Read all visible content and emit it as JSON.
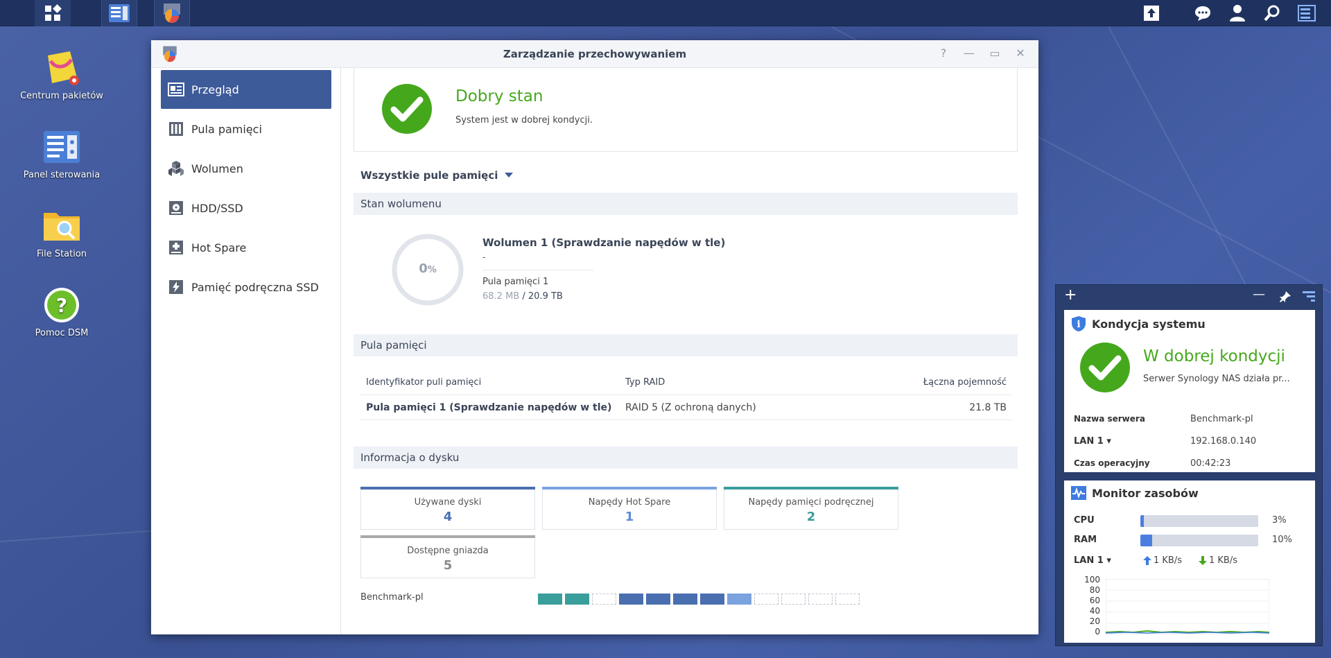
{
  "desktop": {
    "icons": [
      {
        "label": "Centrum pakietów"
      },
      {
        "label": "Panel sterowania"
      },
      {
        "label": "File Station"
      },
      {
        "label": "Pomoc DSM"
      }
    ]
  },
  "window": {
    "title": "Zarządzanie przechowywaniem",
    "controls": {
      "help": "?",
      "minimize": "—",
      "maximize": "▭",
      "close": "✕"
    },
    "sidebar": {
      "items": [
        {
          "label": "Przegląd",
          "icon": "overview-icon",
          "active": true
        },
        {
          "label": "Pula pamięci",
          "icon": "storage-pool-icon"
        },
        {
          "label": "Wolumen",
          "icon": "volume-icon"
        },
        {
          "label": "HDD/SSD",
          "icon": "hdd-icon"
        },
        {
          "label": "Hot Spare",
          "icon": "hot-spare-icon"
        },
        {
          "label": "Pamięć podręczna SSD",
          "icon": "ssd-cache-icon"
        }
      ]
    },
    "status": {
      "title": "Dobry stan",
      "description": "System jest w dobrej kondycji."
    },
    "pool_filter": "Wszystkie pule pamięci",
    "volume_section": {
      "header": "Stan wolumenu",
      "percent": "0",
      "percent_unit": "%",
      "progress": 0,
      "volume_name": "Wolumen 1 (Sprawdzanie napędów w tle)",
      "volume_sub": "-",
      "pool_name": "Pula pamięci 1",
      "used": "68.2 MB",
      "separator": "/",
      "total": "20.9 TB"
    },
    "pool_section": {
      "header": "Pula pamięci",
      "columns": [
        "Identyfikator puli pamięci",
        "Typ RAID",
        "Łączna pojemność"
      ],
      "rows": [
        {
          "id": "Pula pamięci 1 (Sprawdzanie napędów w tle)",
          "raid": "RAID 5 (Z ochroną danych)",
          "capacity": "21.8 TB"
        }
      ]
    },
    "disk_section": {
      "header": "Informacja o dysku",
      "cards": [
        {
          "label": "Używane dyski",
          "value": "4",
          "color": "#4a6fb0"
        },
        {
          "label": "Napędy Hot Spare",
          "value": "1",
          "color": "#7aa3e0"
        },
        {
          "label": "Napędy pamięci podręcznej",
          "value": "2",
          "color": "#3a9e9a"
        },
        {
          "label": "Dostępne gniazda",
          "value": "5",
          "color": "#a9a9a9"
        }
      ],
      "server_label": "Benchmark-pl",
      "slots": [
        "cache",
        "cache",
        "empty",
        "used",
        "used",
        "used",
        "used",
        "spare",
        "empty",
        "empty",
        "empty",
        "empty"
      ]
    }
  },
  "widgets": {
    "system_health": {
      "title": "Kondycja systemu",
      "status": "W dobrej kondycji",
      "description": "Serwer Synology NAS działa pr...",
      "fields": [
        {
          "key": "Nazwa serwera",
          "value": "Benchmark-pl"
        },
        {
          "key": "LAN 1 ▾",
          "value": "192.168.0.140"
        },
        {
          "key": "Czas operacyjny",
          "value": "00:42:23"
        }
      ]
    },
    "resource_monitor": {
      "title": "Monitor zasobów",
      "cpu_label": "CPU",
      "cpu_value": "3%",
      "cpu_level": 3,
      "ram_label": "RAM",
      "ram_value": "10%",
      "ram_level": 10,
      "lan_label": "LAN 1 ▾",
      "upload": "1 KB/s",
      "download": "1 KB/s",
      "chart_ticks": [
        "100",
        "80",
        "60",
        "40",
        "20",
        "0"
      ]
    }
  },
  "colors": {
    "accent": "#3d5a99",
    "ok_green": "#45a81c",
    "taskbar": "#1f325f"
  }
}
